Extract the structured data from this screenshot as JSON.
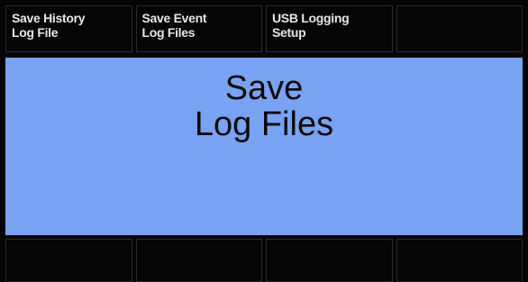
{
  "top_softkeys": [
    {
      "line1": "Save History",
      "line2": "Log File"
    },
    {
      "line1": "Save Event",
      "line2": "Log Files"
    },
    {
      "line1": "USB Logging",
      "line2": "Setup"
    },
    {
      "line1": "",
      "line2": ""
    }
  ],
  "main": {
    "title_line1": "Save",
    "title_line2": "Log Files"
  },
  "bottom_softkeys": [
    {
      "label": ""
    },
    {
      "label": ""
    },
    {
      "label": ""
    },
    {
      "label": ""
    }
  ],
  "colors": {
    "panel_background": "#78a3f2",
    "screen_background": "#050505",
    "softkey_text": "#e6e6e6"
  }
}
